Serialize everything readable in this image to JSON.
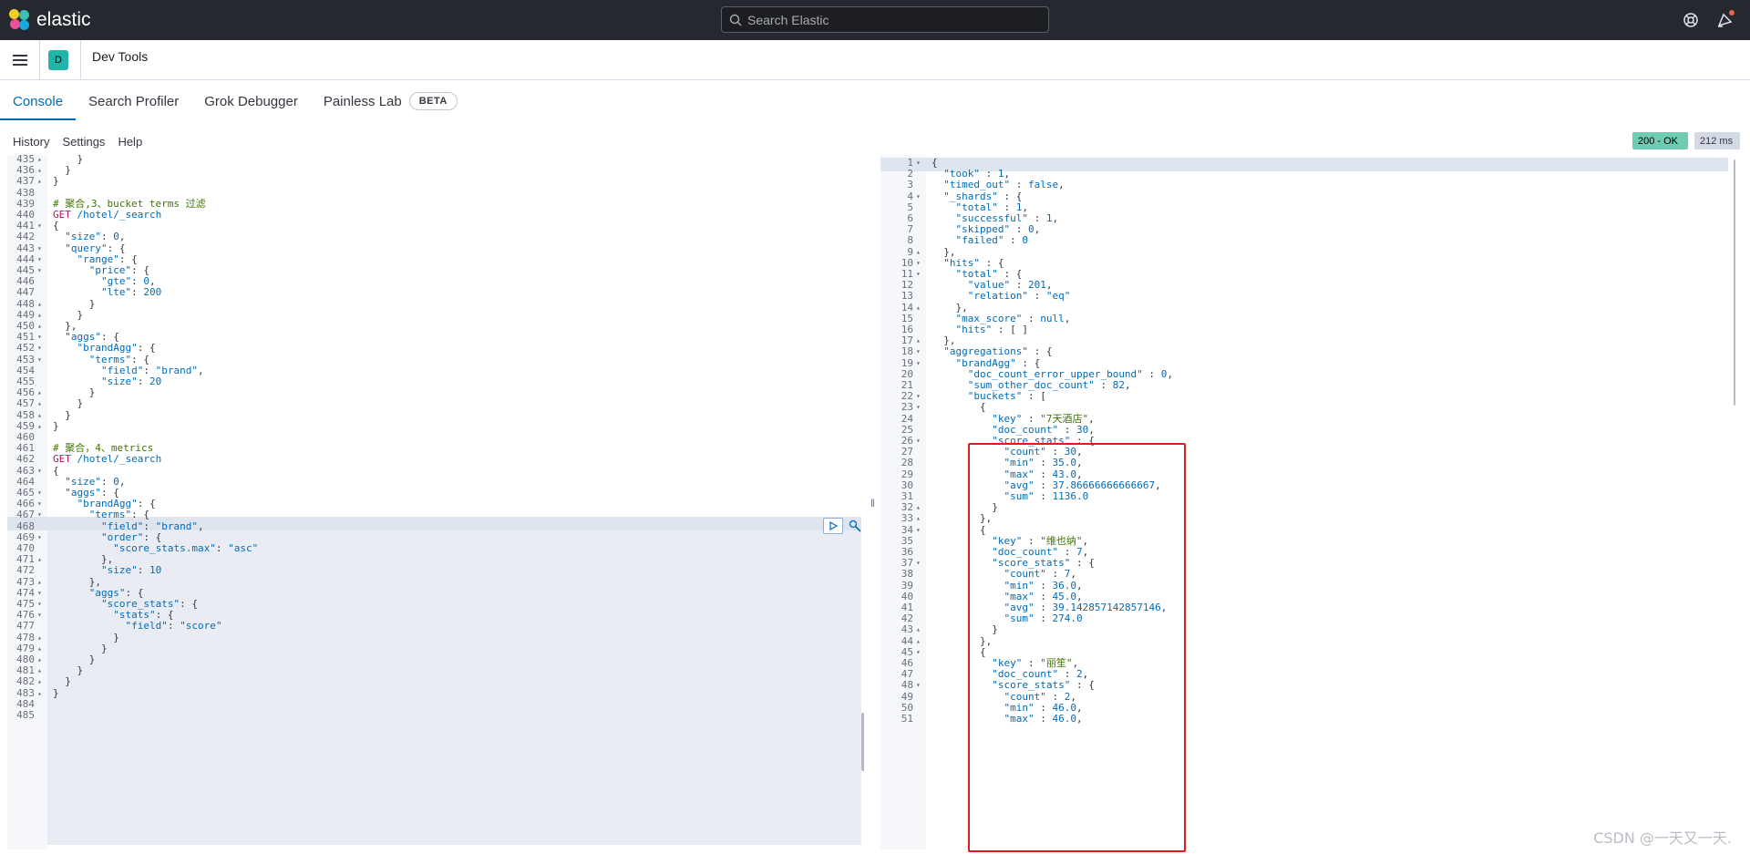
{
  "header": {
    "logo_text": "elastic",
    "search_placeholder": "Search Elastic"
  },
  "app_bar": {
    "space_initial": "D",
    "title": "Dev Tools"
  },
  "tabs": [
    {
      "label": "Console",
      "active": true
    },
    {
      "label": "Search Profiler",
      "active": false
    },
    {
      "label": "Grok Debugger",
      "active": false
    },
    {
      "label": "Painless Lab",
      "active": false
    }
  ],
  "beta_badge": "BETA",
  "console_menu": [
    "History",
    "Settings",
    "Help"
  ],
  "status": {
    "code": "200 - OK",
    "time": "212 ms",
    "ok_color": "#6dccb1",
    "time_color": "#d3dae6"
  },
  "request_editor": {
    "lines": [
      {
        "n": "435",
        "f": "^",
        "t": "    }"
      },
      {
        "n": "436",
        "f": "^",
        "t": "  }"
      },
      {
        "n": "437",
        "f": "^",
        "t": "}"
      },
      {
        "n": "438",
        "f": "",
        "t": ""
      },
      {
        "n": "439",
        "f": "",
        "t": "# 聚合,3、bucket terms 过滤"
      },
      {
        "n": "440",
        "f": "",
        "t": "GET /hotel/_search"
      },
      {
        "n": "441",
        "f": "v",
        "t": "{"
      },
      {
        "n": "442",
        "f": "",
        "t": "  \"size\": 0,"
      },
      {
        "n": "443",
        "f": "v",
        "t": "  \"query\": {"
      },
      {
        "n": "444",
        "f": "v",
        "t": "    \"range\": {"
      },
      {
        "n": "445",
        "f": "v",
        "t": "      \"price\": {"
      },
      {
        "n": "446",
        "f": "",
        "t": "        \"gte\": 0,"
      },
      {
        "n": "447",
        "f": "",
        "t": "        \"lte\": 200"
      },
      {
        "n": "448",
        "f": "^",
        "t": "      }"
      },
      {
        "n": "449",
        "f": "^",
        "t": "    }"
      },
      {
        "n": "450",
        "f": "^",
        "t": "  },"
      },
      {
        "n": "451",
        "f": "v",
        "t": "  \"aggs\": {"
      },
      {
        "n": "452",
        "f": "v",
        "t": "    \"brandAgg\": {"
      },
      {
        "n": "453",
        "f": "v",
        "t": "      \"terms\": {"
      },
      {
        "n": "454",
        "f": "",
        "t": "        \"field\": \"brand\","
      },
      {
        "n": "455",
        "f": "",
        "t": "        \"size\": 20"
      },
      {
        "n": "456",
        "f": "^",
        "t": "      }"
      },
      {
        "n": "457",
        "f": "^",
        "t": "    }"
      },
      {
        "n": "458",
        "f": "^",
        "t": "  }"
      },
      {
        "n": "459",
        "f": "^",
        "t": "}"
      },
      {
        "n": "460",
        "f": "",
        "t": ""
      },
      {
        "n": "461",
        "f": "",
        "t": "# 聚合，4、metrics"
      },
      {
        "n": "462",
        "f": "",
        "t": "GET /hotel/_search"
      },
      {
        "n": "463",
        "f": "v",
        "t": "{"
      },
      {
        "n": "464",
        "f": "",
        "t": "  \"size\": 0,"
      },
      {
        "n": "465",
        "f": "v",
        "t": "  \"aggs\": {"
      },
      {
        "n": "466",
        "f": "v",
        "t": "    \"brandAgg\": {"
      },
      {
        "n": "467",
        "f": "v",
        "t": "      \"terms\": {"
      },
      {
        "n": "468",
        "f": "",
        "t": "        \"field\": \"brand\","
      },
      {
        "n": "469",
        "f": "v",
        "t": "        \"order\": {"
      },
      {
        "n": "470",
        "f": "",
        "t": "          \"score_stats.max\": \"asc\""
      },
      {
        "n": "471",
        "f": "^",
        "t": "        },"
      },
      {
        "n": "472",
        "f": "",
        "t": "        \"size\": 10"
      },
      {
        "n": "473",
        "f": "^",
        "t": "      },"
      },
      {
        "n": "474",
        "f": "v",
        "t": "      \"aggs\": {"
      },
      {
        "n": "475",
        "f": "v",
        "t": "        \"score_stats\": {"
      },
      {
        "n": "476",
        "f": "v",
        "t": "          \"stats\": {"
      },
      {
        "n": "477",
        "f": "",
        "t": "            \"field\": \"score\""
      },
      {
        "n": "478",
        "f": "^",
        "t": "          }"
      },
      {
        "n": "479",
        "f": "^",
        "t": "        }"
      },
      {
        "n": "480",
        "f": "^",
        "t": "      }"
      },
      {
        "n": "481",
        "f": "^",
        "t": "    }"
      },
      {
        "n": "482",
        "f": "^",
        "t": "  }"
      },
      {
        "n": "483",
        "f": "^",
        "t": "}"
      },
      {
        "n": "484",
        "f": "",
        "t": ""
      },
      {
        "n": "485",
        "f": "",
        "t": ""
      }
    ]
  },
  "response_editor": {
    "lines": [
      {
        "n": "1",
        "f": "v",
        "t": "{"
      },
      {
        "n": "2",
        "f": "",
        "t": "  \"took\" : 1,"
      },
      {
        "n": "3",
        "f": "",
        "t": "  \"timed_out\" : false,"
      },
      {
        "n": "4",
        "f": "v",
        "t": "  \"_shards\" : {"
      },
      {
        "n": "5",
        "f": "",
        "t": "    \"total\" : 1,"
      },
      {
        "n": "6",
        "f": "",
        "t": "    \"successful\" : 1,"
      },
      {
        "n": "7",
        "f": "",
        "t": "    \"skipped\" : 0,"
      },
      {
        "n": "8",
        "f": "",
        "t": "    \"failed\" : 0"
      },
      {
        "n": "9",
        "f": "^",
        "t": "  },"
      },
      {
        "n": "10",
        "f": "v",
        "t": "  \"hits\" : {"
      },
      {
        "n": "11",
        "f": "v",
        "t": "    \"total\" : {"
      },
      {
        "n": "12",
        "f": "",
        "t": "      \"value\" : 201,"
      },
      {
        "n": "13",
        "f": "",
        "t": "      \"relation\" : \"eq\""
      },
      {
        "n": "14",
        "f": "^",
        "t": "    },"
      },
      {
        "n": "15",
        "f": "",
        "t": "    \"max_score\" : null,"
      },
      {
        "n": "16",
        "f": "",
        "t": "    \"hits\" : [ ]"
      },
      {
        "n": "17",
        "f": "^",
        "t": "  },"
      },
      {
        "n": "18",
        "f": "v",
        "t": "  \"aggregations\" : {"
      },
      {
        "n": "19",
        "f": "v",
        "t": "    \"brandAgg\" : {"
      },
      {
        "n": "20",
        "f": "",
        "t": "      \"doc_count_error_upper_bound\" : 0,"
      },
      {
        "n": "21",
        "f": "",
        "t": "      \"sum_other_doc_count\" : 82,"
      },
      {
        "n": "22",
        "f": "v",
        "t": "      \"buckets\" : ["
      },
      {
        "n": "23",
        "f": "v",
        "t": "        {"
      },
      {
        "n": "24",
        "f": "",
        "t": "          \"key\" : \"7天酒店\","
      },
      {
        "n": "25",
        "f": "",
        "t": "          \"doc_count\" : 30,"
      },
      {
        "n": "26",
        "f": "v",
        "t": "          \"score_stats\" : {"
      },
      {
        "n": "27",
        "f": "",
        "t": "            \"count\" : 30,"
      },
      {
        "n": "28",
        "f": "",
        "t": "            \"min\" : 35.0,"
      },
      {
        "n": "29",
        "f": "",
        "t": "            \"max\" : 43.0,"
      },
      {
        "n": "30",
        "f": "",
        "t": "            \"avg\" : 37.86666666666667,"
      },
      {
        "n": "31",
        "f": "",
        "t": "            \"sum\" : 1136.0"
      },
      {
        "n": "32",
        "f": "^",
        "t": "          }"
      },
      {
        "n": "33",
        "f": "^",
        "t": "        },"
      },
      {
        "n": "34",
        "f": "v",
        "t": "        {"
      },
      {
        "n": "35",
        "f": "",
        "t": "          \"key\" : \"维也纳\","
      },
      {
        "n": "36",
        "f": "",
        "t": "          \"doc_count\" : 7,"
      },
      {
        "n": "37",
        "f": "v",
        "t": "          \"score_stats\" : {"
      },
      {
        "n": "38",
        "f": "",
        "t": "            \"count\" : 7,"
      },
      {
        "n": "39",
        "f": "",
        "t": "            \"min\" : 36.0,"
      },
      {
        "n": "40",
        "f": "",
        "t": "            \"max\" : 45.0,"
      },
      {
        "n": "41",
        "f": "",
        "t": "            \"avg\" : 39.142857142857146,"
      },
      {
        "n": "42",
        "f": "",
        "t": "            \"sum\" : 274.0"
      },
      {
        "n": "43",
        "f": "^",
        "t": "          }"
      },
      {
        "n": "44",
        "f": "^",
        "t": "        },"
      },
      {
        "n": "45",
        "f": "v",
        "t": "        {"
      },
      {
        "n": "46",
        "f": "",
        "t": "          \"key\" : \"丽笙\","
      },
      {
        "n": "47",
        "f": "",
        "t": "          \"doc_count\" : 2,"
      },
      {
        "n": "48",
        "f": "v",
        "t": "          \"score_stats\" : {"
      },
      {
        "n": "49",
        "f": "",
        "t": "            \"count\" : 2,"
      },
      {
        "n": "50",
        "f": "",
        "t": "            \"min\" : 46.0,"
      },
      {
        "n": "51",
        "f": "",
        "t": "            \"max\" : 46.0,"
      }
    ]
  },
  "watermark": "CSDN @一天又一天."
}
